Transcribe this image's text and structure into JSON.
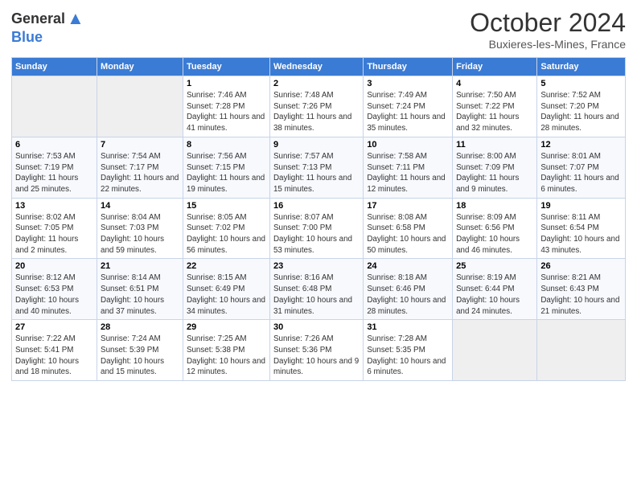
{
  "header": {
    "logo_general": "General",
    "logo_blue": "Blue",
    "month_title": "October 2024",
    "location": "Buxieres-les-Mines, France"
  },
  "days_of_week": [
    "Sunday",
    "Monday",
    "Tuesday",
    "Wednesday",
    "Thursday",
    "Friday",
    "Saturday"
  ],
  "weeks": [
    [
      {
        "num": "",
        "sunrise": "",
        "sunset": "",
        "daylight": ""
      },
      {
        "num": "",
        "sunrise": "",
        "sunset": "",
        "daylight": ""
      },
      {
        "num": "1",
        "sunrise": "Sunrise: 7:46 AM",
        "sunset": "Sunset: 7:28 PM",
        "daylight": "Daylight: 11 hours and 41 minutes."
      },
      {
        "num": "2",
        "sunrise": "Sunrise: 7:48 AM",
        "sunset": "Sunset: 7:26 PM",
        "daylight": "Daylight: 11 hours and 38 minutes."
      },
      {
        "num": "3",
        "sunrise": "Sunrise: 7:49 AM",
        "sunset": "Sunset: 7:24 PM",
        "daylight": "Daylight: 11 hours and 35 minutes."
      },
      {
        "num": "4",
        "sunrise": "Sunrise: 7:50 AM",
        "sunset": "Sunset: 7:22 PM",
        "daylight": "Daylight: 11 hours and 32 minutes."
      },
      {
        "num": "5",
        "sunrise": "Sunrise: 7:52 AM",
        "sunset": "Sunset: 7:20 PM",
        "daylight": "Daylight: 11 hours and 28 minutes."
      }
    ],
    [
      {
        "num": "6",
        "sunrise": "Sunrise: 7:53 AM",
        "sunset": "Sunset: 7:19 PM",
        "daylight": "Daylight: 11 hours and 25 minutes."
      },
      {
        "num": "7",
        "sunrise": "Sunrise: 7:54 AM",
        "sunset": "Sunset: 7:17 PM",
        "daylight": "Daylight: 11 hours and 22 minutes."
      },
      {
        "num": "8",
        "sunrise": "Sunrise: 7:56 AM",
        "sunset": "Sunset: 7:15 PM",
        "daylight": "Daylight: 11 hours and 19 minutes."
      },
      {
        "num": "9",
        "sunrise": "Sunrise: 7:57 AM",
        "sunset": "Sunset: 7:13 PM",
        "daylight": "Daylight: 11 hours and 15 minutes."
      },
      {
        "num": "10",
        "sunrise": "Sunrise: 7:58 AM",
        "sunset": "Sunset: 7:11 PM",
        "daylight": "Daylight: 11 hours and 12 minutes."
      },
      {
        "num": "11",
        "sunrise": "Sunrise: 8:00 AM",
        "sunset": "Sunset: 7:09 PM",
        "daylight": "Daylight: 11 hours and 9 minutes."
      },
      {
        "num": "12",
        "sunrise": "Sunrise: 8:01 AM",
        "sunset": "Sunset: 7:07 PM",
        "daylight": "Daylight: 11 hours and 6 minutes."
      }
    ],
    [
      {
        "num": "13",
        "sunrise": "Sunrise: 8:02 AM",
        "sunset": "Sunset: 7:05 PM",
        "daylight": "Daylight: 11 hours and 2 minutes."
      },
      {
        "num": "14",
        "sunrise": "Sunrise: 8:04 AM",
        "sunset": "Sunset: 7:03 PM",
        "daylight": "Daylight: 10 hours and 59 minutes."
      },
      {
        "num": "15",
        "sunrise": "Sunrise: 8:05 AM",
        "sunset": "Sunset: 7:02 PM",
        "daylight": "Daylight: 10 hours and 56 minutes."
      },
      {
        "num": "16",
        "sunrise": "Sunrise: 8:07 AM",
        "sunset": "Sunset: 7:00 PM",
        "daylight": "Daylight: 10 hours and 53 minutes."
      },
      {
        "num": "17",
        "sunrise": "Sunrise: 8:08 AM",
        "sunset": "Sunset: 6:58 PM",
        "daylight": "Daylight: 10 hours and 50 minutes."
      },
      {
        "num": "18",
        "sunrise": "Sunrise: 8:09 AM",
        "sunset": "Sunset: 6:56 PM",
        "daylight": "Daylight: 10 hours and 46 minutes."
      },
      {
        "num": "19",
        "sunrise": "Sunrise: 8:11 AM",
        "sunset": "Sunset: 6:54 PM",
        "daylight": "Daylight: 10 hours and 43 minutes."
      }
    ],
    [
      {
        "num": "20",
        "sunrise": "Sunrise: 8:12 AM",
        "sunset": "Sunset: 6:53 PM",
        "daylight": "Daylight: 10 hours and 40 minutes."
      },
      {
        "num": "21",
        "sunrise": "Sunrise: 8:14 AM",
        "sunset": "Sunset: 6:51 PM",
        "daylight": "Daylight: 10 hours and 37 minutes."
      },
      {
        "num": "22",
        "sunrise": "Sunrise: 8:15 AM",
        "sunset": "Sunset: 6:49 PM",
        "daylight": "Daylight: 10 hours and 34 minutes."
      },
      {
        "num": "23",
        "sunrise": "Sunrise: 8:16 AM",
        "sunset": "Sunset: 6:48 PM",
        "daylight": "Daylight: 10 hours and 31 minutes."
      },
      {
        "num": "24",
        "sunrise": "Sunrise: 8:18 AM",
        "sunset": "Sunset: 6:46 PM",
        "daylight": "Daylight: 10 hours and 28 minutes."
      },
      {
        "num": "25",
        "sunrise": "Sunrise: 8:19 AM",
        "sunset": "Sunset: 6:44 PM",
        "daylight": "Daylight: 10 hours and 24 minutes."
      },
      {
        "num": "26",
        "sunrise": "Sunrise: 8:21 AM",
        "sunset": "Sunset: 6:43 PM",
        "daylight": "Daylight: 10 hours and 21 minutes."
      }
    ],
    [
      {
        "num": "27",
        "sunrise": "Sunrise: 7:22 AM",
        "sunset": "Sunset: 5:41 PM",
        "daylight": "Daylight: 10 hours and 18 minutes."
      },
      {
        "num": "28",
        "sunrise": "Sunrise: 7:24 AM",
        "sunset": "Sunset: 5:39 PM",
        "daylight": "Daylight: 10 hours and 15 minutes."
      },
      {
        "num": "29",
        "sunrise": "Sunrise: 7:25 AM",
        "sunset": "Sunset: 5:38 PM",
        "daylight": "Daylight: 10 hours and 12 minutes."
      },
      {
        "num": "30",
        "sunrise": "Sunrise: 7:26 AM",
        "sunset": "Sunset: 5:36 PM",
        "daylight": "Daylight: 10 hours and 9 minutes."
      },
      {
        "num": "31",
        "sunrise": "Sunrise: 7:28 AM",
        "sunset": "Sunset: 5:35 PM",
        "daylight": "Daylight: 10 hours and 6 minutes."
      },
      {
        "num": "",
        "sunrise": "",
        "sunset": "",
        "daylight": ""
      },
      {
        "num": "",
        "sunrise": "",
        "sunset": "",
        "daylight": ""
      }
    ]
  ]
}
